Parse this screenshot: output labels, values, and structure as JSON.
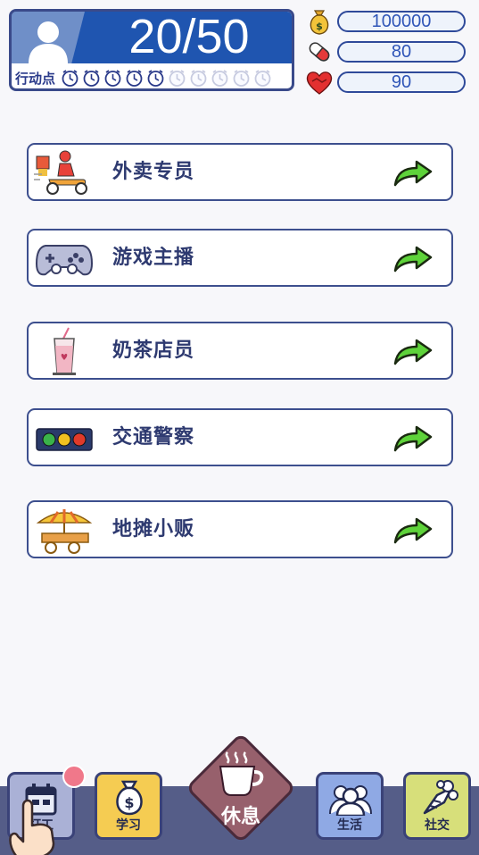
{
  "hud": {
    "action_points": "20/50",
    "action_points_label": "行动点",
    "action_points_filled": 5,
    "action_points_total": 10
  },
  "stats": [
    {
      "name": "money",
      "icon": "money-bag-icon",
      "value": "100000"
    },
    {
      "name": "health",
      "icon": "pill-icon",
      "value": "80"
    },
    {
      "name": "mood",
      "icon": "heart-handshake-icon",
      "value": "90"
    }
  ],
  "jobs": [
    {
      "name": "外卖专员",
      "icon": "delivery-scooter-icon"
    },
    {
      "name": "游戏主播",
      "icon": "gamepad-icon"
    },
    {
      "name": "奶茶店员",
      "icon": "milk-tea-icon"
    },
    {
      "name": "交通警察",
      "icon": "traffic-light-icon"
    },
    {
      "name": "地摊小贩",
      "icon": "street-stall-icon"
    }
  ],
  "nav": {
    "work_label": "打工",
    "study_label": "学习",
    "rest_label": "休息",
    "life_label": "生活",
    "social_label": "社交"
  },
  "colors": {
    "hud_blue": "#1f55b0",
    "arrow_green": "#5ed33a",
    "nav_bar": "#555d88",
    "rest_button": "#97606c"
  }
}
